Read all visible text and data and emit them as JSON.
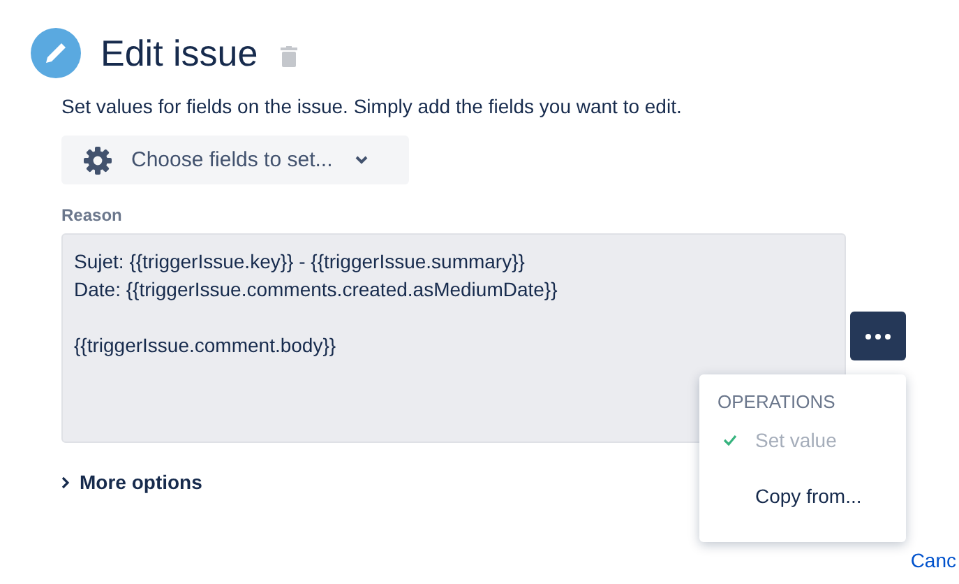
{
  "header": {
    "title": "Edit issue"
  },
  "description": "Set values for fields on the issue. Simply add the fields you want to edit.",
  "field_chooser": {
    "label": "Choose fields to set..."
  },
  "reason": {
    "label": "Reason",
    "value": "Sujet: {{triggerIssue.key}} - {{triggerIssue.summary}}\nDate: {{triggerIssue.comments.created.asMediumDate}}\n\n{{triggerIssue.comment.body}}"
  },
  "operations_menu": {
    "heading": "OPERATIONS",
    "items": [
      {
        "label": "Set value",
        "selected": true
      },
      {
        "label": "Copy from...",
        "selected": false
      }
    ]
  },
  "more_options": {
    "label": "More options"
  },
  "footer": {
    "cancel": "Canc"
  }
}
